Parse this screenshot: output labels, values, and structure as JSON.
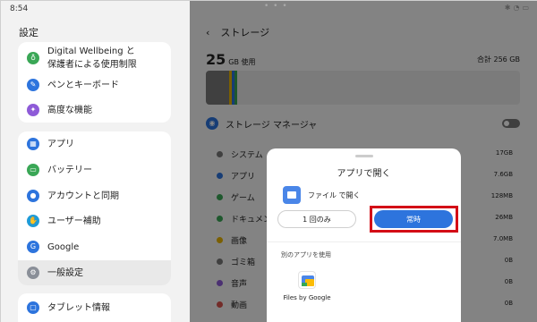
{
  "statusbar": {
    "time": "8:54",
    "dots": "• • •",
    "icons": [
      "bluetooth-icon",
      "wifi-icon",
      "battery-icon"
    ]
  },
  "left": {
    "title": "設定",
    "card1": [
      {
        "label_line1": "Digital Wellbeing と",
        "label_line2": "保護者による使用制限",
        "icon": "wellbeing-icon",
        "color": "#3aa756"
      },
      {
        "label": "ペンとキーボード",
        "icon": "pen-icon",
        "color": "#2d74dd"
      },
      {
        "label": "高度な機能",
        "icon": "advanced-icon",
        "color": "#8e5bd8"
      }
    ],
    "card2": [
      {
        "label": "アプリ",
        "icon": "apps-icon",
        "color": "#2d74dd"
      },
      {
        "label": "バッテリー",
        "icon": "battery-icon",
        "color": "#3aa756"
      },
      {
        "label": "アカウントと同期",
        "icon": "account-icon",
        "color": "#2d74dd"
      },
      {
        "label": "ユーザー補助",
        "icon": "accessibility-icon",
        "color": "#1f9bd6"
      },
      {
        "label": "Google",
        "icon": "google-icon",
        "color": "#2d74dd"
      },
      {
        "label": "一般設定",
        "icon": "gear-icon",
        "color": "#8a8f98",
        "selected": true
      }
    ],
    "card3": [
      {
        "label": "タブレット情報",
        "icon": "tablet-info-icon",
        "color": "#2d74dd"
      }
    ]
  },
  "right": {
    "back": "‹",
    "title": "ストレージ",
    "used_value": "25",
    "used_unit": "GB 使用",
    "total": "合計 256 GB",
    "bar_segments": [
      {
        "color": "#7a7a7a",
        "fraction": 0.075
      },
      {
        "color": "#e8b400",
        "fraction": 0.008
      },
      {
        "color": "#2d74dd",
        "fraction": 0.008
      },
      {
        "color": "#3aa756",
        "fraction": 0.01
      }
    ],
    "manager": {
      "label": "ストレージ マネージャ",
      "toggle": false
    },
    "rows": [
      {
        "name": "システム",
        "size": "17GB",
        "color": "#7a7a7a"
      },
      {
        "name": "アプリ",
        "size": "7.6GB",
        "color": "#2d74dd"
      },
      {
        "name": "ゲーム",
        "size": "128MB",
        "color": "#3aa756"
      },
      {
        "name": "ドキュメント",
        "size": "26MB",
        "color": "#3aa756"
      },
      {
        "name": "画像",
        "size": "7.0MB",
        "color": "#e8b400"
      },
      {
        "name": "ゴミ箱",
        "size": "0B",
        "color": "#7a7a7a"
      },
      {
        "name": "音声",
        "size": "0B",
        "color": "#8e5bd8"
      },
      {
        "name": "動画",
        "size": "0B",
        "color": "#d9534f"
      }
    ]
  },
  "dialog": {
    "title": "アプリで開く",
    "app_label": "ファイル で開く",
    "once_label": "1 回のみ",
    "always_label": "常時",
    "other_apps": "別のアプリを使用",
    "files_by_google": "Files by Google"
  }
}
